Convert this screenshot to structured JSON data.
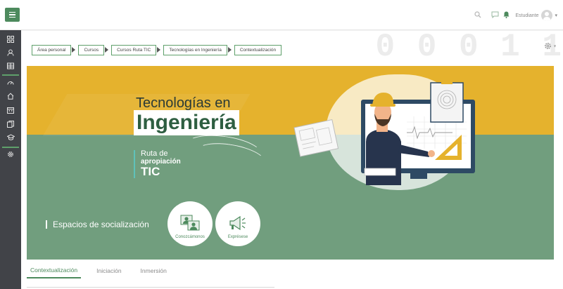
{
  "header": {
    "menu_icon": "hamburger-icon",
    "search_icon": "search-icon",
    "messages_icon": "chat-icon",
    "notifications_icon": "bell-icon",
    "user_name": "Estudiante",
    "user_menu_icon": "chevron-down-icon"
  },
  "sidebar": {
    "items": [
      {
        "icon": "dashboard-icon"
      },
      {
        "icon": "profile-icon"
      },
      {
        "icon": "calendar-grid-icon"
      },
      {
        "icon": "speedometer-icon"
      },
      {
        "icon": "home-icon"
      },
      {
        "icon": "calendar-icon"
      },
      {
        "icon": "files-icon"
      },
      {
        "icon": "graduation-cap-icon"
      },
      {
        "icon": "settings-icon"
      }
    ]
  },
  "breadcrumb": {
    "items": [
      "Área personal",
      "Cursos",
      "Cursos Ruta TIC",
      "Tecnologías en Ingeniería",
      "Contextualización"
    ]
  },
  "settings_menu": {
    "icon": "gear-icon",
    "caret": "▾"
  },
  "background_digits": "0 0 0 1 1",
  "banner": {
    "title_line1": "Tecnologías en",
    "title_line2": "Ingeniería",
    "ruta_line1": "Ruta de",
    "ruta_line2": "apropiación",
    "ruta_line3": "TIC",
    "section_label": "Espacios de socialización",
    "buttons": [
      {
        "label": "Conozcámonos",
        "icon": "people-icon"
      },
      {
        "label": "Exprésese",
        "icon": "megaphone-icon"
      }
    ]
  },
  "tabs": [
    {
      "label": "Contextualización",
      "active": true
    },
    {
      "label": "Iniciación",
      "active": false
    },
    {
      "label": "Inmersión",
      "active": false
    }
  ],
  "colors": {
    "brand_green": "#4d8a5d",
    "banner_yellow": "#e5b22d",
    "banner_green": "#719e7e",
    "sidebar_bg": "#414348"
  }
}
